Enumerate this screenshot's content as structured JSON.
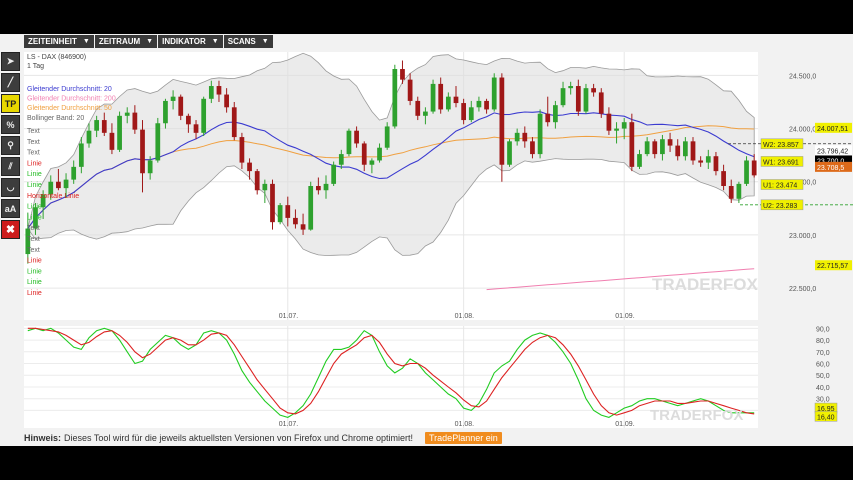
{
  "menu": [
    {
      "label": "ZEITEINHEIT"
    },
    {
      "label": "ZEITRAUM"
    },
    {
      "label": "INDIKATOR"
    },
    {
      "label": "SCANS"
    }
  ],
  "tools": [
    {
      "icon": "cursor-icon",
      "glyph": "➤"
    },
    {
      "icon": "line-tool-icon",
      "glyph": "╱"
    },
    {
      "icon": "tradeplanner-icon",
      "glyph": "TP"
    },
    {
      "icon": "percent-icon",
      "glyph": "%"
    },
    {
      "icon": "search-icon",
      "glyph": "⚲"
    },
    {
      "icon": "parallel-lines-icon",
      "glyph": "⫽"
    },
    {
      "icon": "arc-icon",
      "glyph": "◡"
    },
    {
      "icon": "text-tool-icon",
      "glyph": "aA"
    },
    {
      "icon": "delete-icon",
      "glyph": "✖"
    }
  ],
  "footer": {
    "hint_label": "Hinweis:",
    "hint_text": "Dieses Tool wird für die jeweils aktuellsten Versionen von Firefox und Chrome optimiert!",
    "button": "TradePlanner ein"
  },
  "colors": {
    "up": "#2ea12e",
    "down": "#a01818",
    "sma20": "#3b3bd0",
    "sma50": "#f0a040",
    "sma200": "#f07fb0",
    "band_fill": "#dedede",
    "band_line": "#9a9a9a",
    "stoch_k": "#22cc22",
    "stoch_d": "#dd2222",
    "label_bg": "#f0f000"
  },
  "chart_data": [
    {
      "type": "candlestick",
      "title": "LS - DAX (846900)",
      "subtitle": "1 Tag",
      "legend": [
        {
          "name": "Gleitender Durchschnitt: 20",
          "color": "#3b3bd0"
        },
        {
          "name": "Gleitender Durchschnitt: 200",
          "color": "#f07fb0"
        },
        {
          "name": "Gleitender Durchschnitt: 50",
          "color": "#f0a040"
        },
        {
          "name": "Bollinger Band: 20",
          "color": "#666666"
        }
      ],
      "drawing_labels": [
        {
          "text": "Text",
          "color": "#666666"
        },
        {
          "text": "Text",
          "color": "#666666"
        },
        {
          "text": "Text",
          "color": "#666666"
        },
        {
          "text": "Linie",
          "color": "#dd2222"
        },
        {
          "text": "Linie",
          "color": "#22bb22"
        },
        {
          "text": "Linie",
          "color": "#22bb22"
        },
        {
          "text": "Horizontale Linie",
          "color": "#dd2222"
        },
        {
          "text": "Linie",
          "color": "#22bb22"
        },
        {
          "text": "Linie",
          "color": "#22bb22"
        },
        {
          "text": "Text",
          "color": "#666666"
        },
        {
          "text": "Text",
          "color": "#666666"
        },
        {
          "text": "Text",
          "color": "#666666"
        },
        {
          "text": "Linie",
          "color": "#dd2222"
        },
        {
          "text": "Linie",
          "color": "#22bb22"
        },
        {
          "text": "Linie",
          "color": "#22bb22"
        },
        {
          "text": "Linie",
          "color": "#dd2222"
        }
      ],
      "y_ticks": [
        "24.500,0",
        "24.000,0",
        "23.500,0",
        "23.000,0",
        "22.500,0"
      ],
      "y_tick_values": [
        24500,
        24000,
        23500,
        23000,
        22500
      ],
      "ylim": [
        22200,
        24720
      ],
      "x_ticks": [
        {
          "label": "01.07.",
          "index": 34
        },
        {
          "label": "01.08.",
          "index": 57
        },
        {
          "label": "01.09.",
          "index": 78
        }
      ],
      "bars": 96,
      "ohlc": [
        [
          22820,
          23210,
          22730,
          23060
        ],
        [
          23060,
          23300,
          23000,
          23260
        ],
        [
          23260,
          23420,
          23150,
          23380
        ],
        [
          23380,
          23560,
          23330,
          23500
        ],
        [
          23500,
          23620,
          23420,
          23440
        ],
        [
          23440,
          23580,
          23350,
          23520
        ],
        [
          23520,
          23700,
          23480,
          23640
        ],
        [
          23640,
          23920,
          23580,
          23860
        ],
        [
          23860,
          24050,
          23820,
          23980
        ],
        [
          23980,
          24120,
          23920,
          24080
        ],
        [
          24080,
          24150,
          23930,
          23960
        ],
        [
          23960,
          24050,
          23760,
          23800
        ],
        [
          23800,
          24160,
          23780,
          24120
        ],
        [
          24120,
          24200,
          24050,
          24150
        ],
        [
          24150,
          24220,
          23950,
          23990
        ],
        [
          23990,
          24080,
          23400,
          23580
        ],
        [
          23580,
          23740,
          23520,
          23700
        ],
        [
          23700,
          24100,
          23680,
          24050
        ],
        [
          24050,
          24280,
          24000,
          24260
        ],
        [
          24260,
          24360,
          24180,
          24300
        ],
        [
          24300,
          24320,
          24080,
          24120
        ],
        [
          24120,
          24140,
          23960,
          24040
        ],
        [
          24040,
          24080,
          23900,
          23960
        ],
        [
          23960,
          24300,
          23930,
          24280
        ],
        [
          24280,
          24450,
          24240,
          24400
        ],
        [
          24400,
          24450,
          24250,
          24320
        ],
        [
          24320,
          24380,
          24150,
          24200
        ],
        [
          24200,
          24250,
          23890,
          23920
        ],
        [
          23920,
          23960,
          23620,
          23680
        ],
        [
          23680,
          23720,
          23520,
          23600
        ],
        [
          23600,
          23620,
          23380,
          23420
        ],
        [
          23420,
          23520,
          23300,
          23480
        ],
        [
          23480,
          23520,
          23050,
          23120
        ],
        [
          23120,
          23300,
          23100,
          23280
        ],
        [
          23280,
          23360,
          23080,
          23160
        ],
        [
          23160,
          23240,
          23060,
          23100
        ],
        [
          23100,
          23200,
          23000,
          23050
        ],
        [
          23050,
          23500,
          23040,
          23460
        ],
        [
          23460,
          23540,
          23380,
          23420
        ],
        [
          23420,
          23560,
          23340,
          23480
        ],
        [
          23480,
          23690,
          23460,
          23660
        ],
        [
          23660,
          23800,
          23620,
          23760
        ],
        [
          23760,
          24000,
          23740,
          23980
        ],
        [
          23980,
          24020,
          23820,
          23860
        ],
        [
          23860,
          23880,
          23600,
          23660
        ],
        [
          23660,
          23720,
          23580,
          23700
        ],
        [
          23700,
          23860,
          23680,
          23820
        ],
        [
          23820,
          24060,
          23800,
          24020
        ],
        [
          24020,
          24600,
          24000,
          24560
        ],
        [
          24560,
          24640,
          24420,
          24460
        ],
        [
          24460,
          24520,
          24220,
          24260
        ],
        [
          24260,
          24300,
          24080,
          24120
        ],
        [
          24120,
          24200,
          24040,
          24160
        ],
        [
          24160,
          24460,
          24140,
          24420
        ],
        [
          24420,
          24480,
          24140,
          24180
        ],
        [
          24180,
          24340,
          24160,
          24300
        ],
        [
          24300,
          24400,
          24200,
          24240
        ],
        [
          24240,
          24280,
          24040,
          24080
        ],
        [
          24080,
          24260,
          24060,
          24200
        ],
        [
          24200,
          24300,
          24160,
          24260
        ],
        [
          24260,
          24280,
          24140,
          24180
        ],
        [
          24180,
          24520,
          24160,
          24480
        ],
        [
          24480,
          24520,
          23500,
          23660
        ],
        [
          23660,
          23900,
          23640,
          23880
        ],
        [
          23880,
          24000,
          23840,
          23960
        ],
        [
          23960,
          24020,
          23820,
          23880
        ],
        [
          23880,
          23920,
          23720,
          23760
        ],
        [
          23760,
          24180,
          23720,
          24140
        ],
        [
          24140,
          24300,
          24020,
          24060
        ],
        [
          24060,
          24260,
          24000,
          24220
        ],
        [
          24220,
          24440,
          24200,
          24380
        ],
        [
          24380,
          24440,
          24320,
          24400
        ],
        [
          24400,
          24460,
          24120,
          24160
        ],
        [
          24160,
          24420,
          24140,
          24380
        ],
        [
          24380,
          24420,
          24300,
          24340
        ],
        [
          24340,
          24380,
          24100,
          24140
        ],
        [
          24140,
          24200,
          23940,
          23980
        ],
        [
          23980,
          24060,
          23860,
          24000
        ],
        [
          24000,
          24100,
          23900,
          24060
        ],
        [
          24060,
          24140,
          23600,
          23640
        ],
        [
          23640,
          23800,
          23620,
          23760
        ],
        [
          23760,
          23920,
          23740,
          23880
        ],
        [
          23880,
          23900,
          23720,
          23760
        ],
        [
          23760,
          23940,
          23700,
          23900
        ],
        [
          23900,
          23960,
          23780,
          23840
        ],
        [
          23840,
          23900,
          23700,
          23740
        ],
        [
          23740,
          23920,
          23700,
          23880
        ],
        [
          23880,
          23920,
          23660,
          23700
        ],
        [
          23700,
          23740,
          23640,
          23680
        ],
        [
          23680,
          23800,
          23620,
          23740
        ],
        [
          23740,
          23780,
          23560,
          23600
        ],
        [
          23600,
          23660,
          23420,
          23460
        ],
        [
          23460,
          23520,
          23300,
          23340
        ],
        [
          23340,
          23500,
          23300,
          23480
        ],
        [
          23480,
          23740,
          23460,
          23700
        ],
        [
          23700,
          23760,
          23540,
          23560
        ]
      ],
      "price_labels": [
        {
          "text": "24.007,51",
          "value": 24007,
          "bg": "#f0f000",
          "color": "#222222"
        },
        {
          "text": "W2: 23.857",
          "value": 23857,
          "bg": "#f0f000",
          "color": "#222222"
        },
        {
          "text": "23.796,42",
          "value": 23796,
          "bg": "#ffffff",
          "color": "#222222"
        },
        {
          "text": "23.700,0",
          "value": 23700,
          "bg": "#000000",
          "color": "#ffffff"
        },
        {
          "text": "W1: 23.691",
          "value": 23691,
          "bg": "#f0f000",
          "color": "#222222"
        },
        {
          "text": "23.708,5",
          "value": 23640,
          "bg": "#dd6a1a",
          "color": "#ffffff"
        },
        {
          "text": "U1: 23.474",
          "value": 23474,
          "bg": "#f0f000",
          "color": "#222222"
        },
        {
          "text": "U2: 23.283",
          "value": 23283,
          "bg": "#f0f000",
          "color": "#222222"
        },
        {
          "text": "22.715,57",
          "value": 22715,
          "bg": "#f0f000",
          "color": "#222222"
        }
      ],
      "watermark": "TRADERFOX"
    },
    {
      "type": "line",
      "name": "stochastic",
      "y_ticks": [
        "90,0",
        "80,0",
        "70,0",
        "60,0",
        "50,0",
        "40,0",
        "30,0",
        "20,0"
      ],
      "y_tick_values": [
        90,
        80,
        70,
        60,
        50,
        40,
        30,
        20
      ],
      "ylim": [
        5,
        92
      ],
      "series": [
        {
          "name": "K",
          "color": "#22cc22",
          "values": [
            88,
            90,
            88,
            90,
            86,
            80,
            74,
            72,
            82,
            88,
            90,
            88,
            80,
            70,
            60,
            62,
            72,
            78,
            84,
            82,
            76,
            72,
            76,
            86,
            88,
            86,
            80,
            68,
            54,
            44,
            36,
            28,
            22,
            16,
            14,
            18,
            24,
            34,
            48,
            62,
            72,
            72,
            74,
            80,
            88,
            84,
            70,
            58,
            52,
            56,
            64,
            60,
            52,
            46,
            40,
            34,
            30,
            22,
            20,
            26,
            38,
            52,
            58,
            62,
            72,
            80,
            84,
            86,
            84,
            78,
            70,
            60,
            46,
            30,
            20,
            16,
            14,
            18,
            22,
            24,
            28,
            30,
            30,
            28,
            26,
            24,
            26,
            28,
            30,
            28,
            24,
            20,
            18,
            18,
            18,
            18
          ]
        },
        {
          "name": "D",
          "color": "#dd2222",
          "values": [
            90,
            90,
            89,
            88,
            87,
            84,
            80,
            76,
            78,
            83,
            87,
            88,
            84,
            78,
            70,
            65,
            68,
            74,
            80,
            82,
            80,
            76,
            76,
            80,
            85,
            86,
            84,
            76,
            66,
            56,
            46,
            38,
            30,
            22,
            18,
            17,
            20,
            26,
            36,
            48,
            60,
            68,
            72,
            76,
            82,
            84,
            78,
            68,
            60,
            58,
            60,
            60,
            56,
            50,
            45,
            40,
            35,
            29,
            24,
            23,
            28,
            38,
            48,
            56,
            64,
            72,
            78,
            82,
            84,
            82,
            76,
            68,
            58,
            46,
            34,
            24,
            18,
            16,
            18,
            20,
            24,
            26,
            28,
            28,
            28,
            26,
            26,
            27,
            28,
            28,
            26,
            24,
            22,
            20,
            18,
            17
          ]
        }
      ],
      "value_labels": [
        {
          "text": "16,95",
          "value": 22
        },
        {
          "text": "16,40",
          "value": 15
        }
      ],
      "x_ticks": [
        {
          "label": "01.07.",
          "index": 34
        },
        {
          "label": "01.08.",
          "index": 57
        },
        {
          "label": "01.09.",
          "index": 78
        }
      ],
      "watermark": "TRADERFOX"
    }
  ]
}
